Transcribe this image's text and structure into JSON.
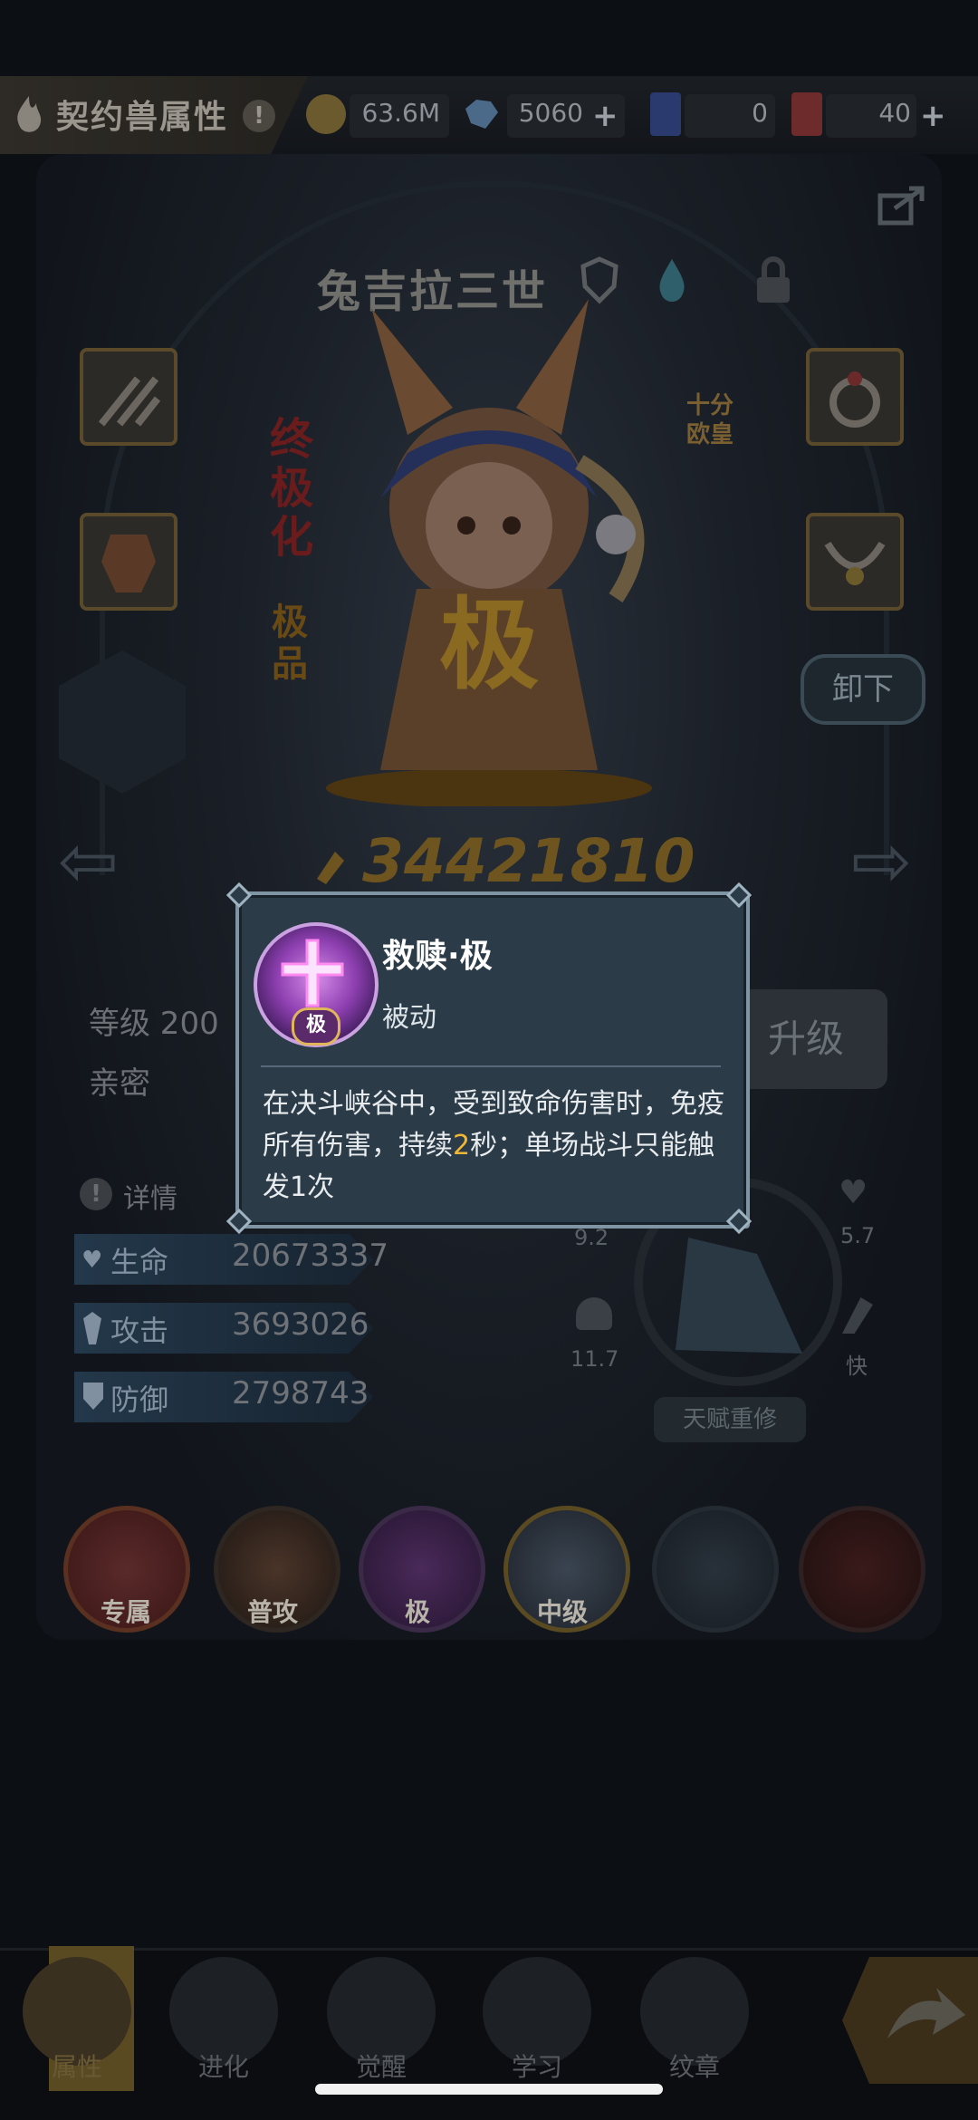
{
  "header": {
    "title": "契约兽属性",
    "gold": "63.6M",
    "gems": "5060",
    "card_a": "0",
    "card_b": "40"
  },
  "pet": {
    "name": "兔吉拉三世",
    "badge_right": "十分\n欧皇",
    "badge_left_1": "终极化",
    "badge_left_2": "极品",
    "power": "34421810",
    "unload_label": "卸下",
    "level_label": "等级 200",
    "intimacy_label": "亲密",
    "upgrade_label": "升级"
  },
  "stats": {
    "details_label": "详情",
    "rows": [
      {
        "label": "生命",
        "value": "20673337"
      },
      {
        "label": "攻击",
        "value": "3693026"
      },
      {
        "label": "防御",
        "value": "2798743"
      }
    ],
    "radar": {
      "top_left": "9.2",
      "top_right": "5.7",
      "bottom_left": "11.7",
      "bottom_right": "快"
    },
    "talent_label": "天赋重修"
  },
  "skills": [
    {
      "label": "专属"
    },
    {
      "label": "普攻"
    },
    {
      "label": "极"
    },
    {
      "label": "中级"
    },
    {
      "label": ""
    },
    {
      "label": ""
    }
  ],
  "popup": {
    "skill_name": "救赎·极",
    "skill_type": "被动",
    "icon_tag": "极",
    "desc_part1": "在决斗峡谷中，受到致命伤害时，免疫所有伤害，持续",
    "desc_highlight": "2",
    "desc_part2": "秒；单场战斗只能触发1次",
    "highlight_color": "#f1b735"
  },
  "nav": [
    {
      "label": "属性"
    },
    {
      "label": "进化"
    },
    {
      "label": "觉醒"
    },
    {
      "label": "学习"
    },
    {
      "label": "纹章"
    }
  ]
}
